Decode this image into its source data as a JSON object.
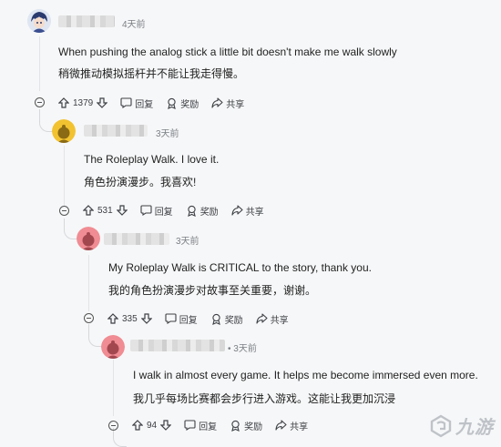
{
  "comments": [
    {
      "time": "4天前",
      "text_en": "When pushing the analog stick a little bit doesn't make me walk slowly",
      "text_zh": "稍微推动模拟摇杆并不能让我走得慢。",
      "votes": "1379"
    },
    {
      "time": "3天前",
      "text_en": "The Roleplay Walk. I love it.",
      "text_zh": "角色扮演漫步。我喜欢!",
      "votes": "531"
    },
    {
      "time": "3天前",
      "text_en": "My Roleplay Walk is CRITICAL to the story, thank you.",
      "text_zh": "我的角色扮演漫步对故事至关重要，谢谢。",
      "votes": "335"
    },
    {
      "time": "• 3天前",
      "text_en": "I walk in almost every game. It helps me become immersed even more.",
      "text_zh": "我几乎每场比赛都会步行进入游戏。这能让我更加沉浸",
      "votes": "94"
    }
  ],
  "actions": {
    "reply": "回复",
    "award": "奖励",
    "share": "共享"
  },
  "watermark": "九游",
  "colors": {
    "background": "#f6f7f8",
    "avatar_yellow": "#f2c230",
    "avatar_pink": "#f08c93"
  }
}
